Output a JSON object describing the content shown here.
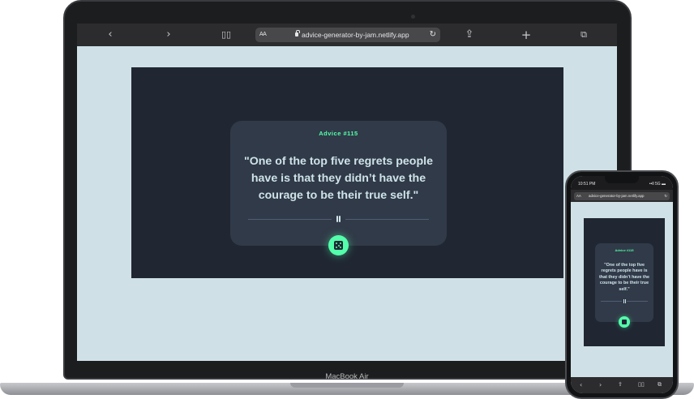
{
  "browser": {
    "text_size_label": "AA",
    "url": "advice-generator-by-jam.netlify.app",
    "icons": {
      "back": "chevron-left-icon",
      "forward": "chevron-right-icon",
      "bookmarks": "book-icon",
      "reload": "reload-icon",
      "share": "share-icon",
      "new_tab": "plus-icon",
      "tabs": "tabs-icon"
    }
  },
  "advice_card": {
    "advice_id": "Advice #115",
    "quote": "\"One of the top five regrets people have is that they didn’t have the courage to be their true self.\""
  },
  "device": {
    "laptop_label": "MacBook Air"
  },
  "phone": {
    "time": "10:51 PM",
    "signal": "••ll 5G ▬",
    "text_size_label": "AA",
    "url": "advice-generator-by-jam.netlify.app",
    "advice_id": "Advice #115",
    "quote": "\"One of the top five regrets people have is that they didn’t have the courage to be their true self.\""
  },
  "colors": {
    "accent": "#53ffab",
    "page_bg": "#202733",
    "card_bg": "#313a48",
    "text": "#cee3e9",
    "screen_bg": "#cfe1e6"
  }
}
